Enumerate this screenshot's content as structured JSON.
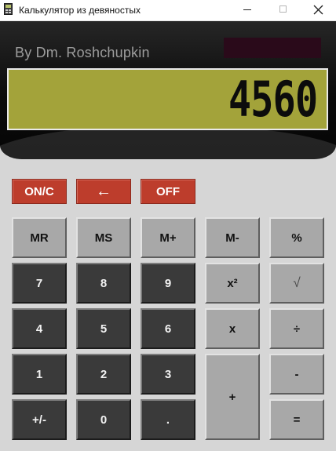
{
  "window": {
    "title": "Калькулятор из девяностых",
    "icon": "calculator-icon",
    "controls": [
      "minimize-icon",
      "maximize-icon",
      "close-icon"
    ]
  },
  "header": {
    "author": "By Dm. Roshchupkin",
    "display_value": "4560",
    "colors": {
      "panel_top": "#262626",
      "display_bg": "#a3a33a",
      "display_text": "#0c0c0c",
      "indicator": "#2a0a1a"
    }
  },
  "buttons": {
    "on_c": "ON/C",
    "backspace": "←",
    "off": "OFF",
    "mr": "MR",
    "ms": "MS",
    "m_plus": "M+",
    "m_minus": "M-",
    "percent": "%",
    "seven": "7",
    "eight": "8",
    "nine": "9",
    "square": "x²",
    "sqrt": "√",
    "four": "4",
    "five": "5",
    "six": "6",
    "multiply": "x",
    "divide": "÷",
    "one": "1",
    "two": "2",
    "three": "3",
    "plus": "+",
    "minus": "-",
    "negate": "+/-",
    "zero": "0",
    "dot": ".",
    "equals": "="
  },
  "colors": {
    "red_button": "#bd3d2c",
    "gray_button": "#a8a8a8",
    "dark_button": "#3a3a3a",
    "body": "#d6d6d6"
  }
}
